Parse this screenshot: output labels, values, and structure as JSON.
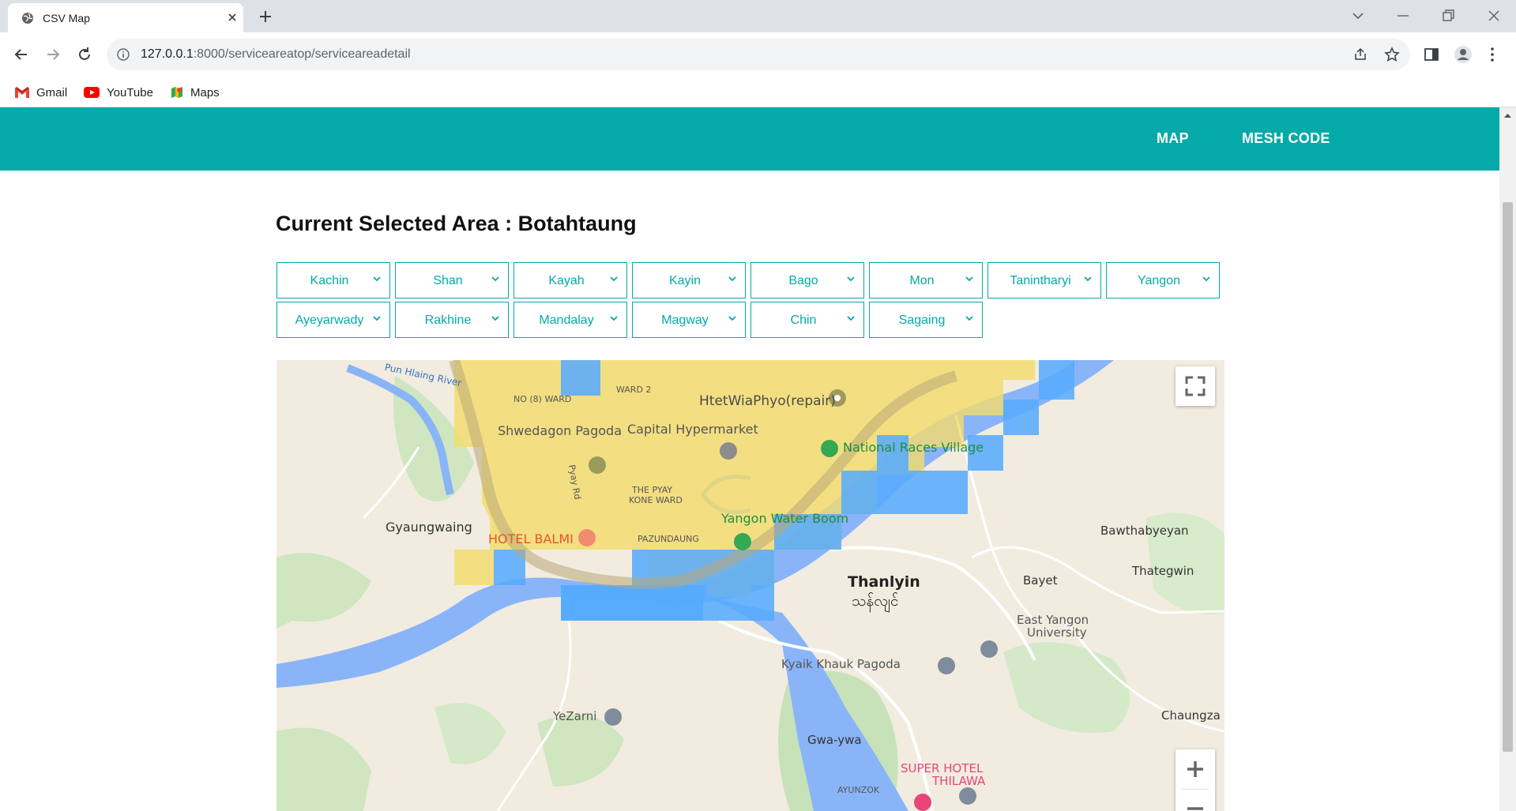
{
  "browser": {
    "tab_title": "CSV Map",
    "url_host": "127.0.0.1",
    "url_rest": ":8000/serviceareatop/serviceareadetail",
    "bookmarks": [
      "Gmail",
      "YouTube",
      "Maps"
    ]
  },
  "navbar": {
    "links": [
      "MAP",
      "MESH CODE"
    ],
    "background": "#04aaa8"
  },
  "main": {
    "heading": "Current Selected Area : Botahtaung",
    "regions_row1": [
      "Kachin",
      "Shan",
      "Kayah",
      "Kayin",
      "Bago",
      "Mon",
      "Tanintharyi",
      "Yangon"
    ],
    "regions_row2": [
      "Ayeyarwady",
      "Rakhine",
      "Mandalay",
      "Magway",
      "Chin",
      "Sagaing"
    ]
  },
  "map": {
    "labels": {
      "pun_hlaing_river": "Pun Hlaing River",
      "no8_ward": "NO (8) WARD",
      "ward2": "WARD 2",
      "htet": "HtetWiaPhyo(repair)",
      "shwedagon": "Shwedagon Pagoda",
      "capital": "Capital Hypermarket",
      "national_races": "National Races Village",
      "pyay_rd": "Pyay Rd",
      "the_pyay": "THE PYAY",
      "kone_ward": "KONE WARD",
      "gyaungwaing": "Gyaungwaing",
      "hotel_balmi": "HOTEL BALMI",
      "pazundaung": "PAZUNDAUNG",
      "water_boom": "Yangon Water Boom",
      "bawthabyeyan": "Bawthabyeyan",
      "thanlyin": "Thanlyin",
      "thanlyin_my": "သန်လျင်",
      "bayet": "Bayet",
      "thategwin": "Thategwin",
      "east_yangon": "East Yangon",
      "university": "University",
      "kyaik_khauk": "Kyaik Khauk Pagoda",
      "yezarni": "YeZarni",
      "chaungza": "Chaungza",
      "gwa_ywa": "Gwa-ywa",
      "super_hotel": "SUPER HOTEL",
      "thilawa": "THILAWA",
      "ayunzok": "AYUNZOK"
    },
    "controls": [
      "fullscreen-icon",
      "zoom-in-icon",
      "zoom-out-icon"
    ],
    "overlay_colors": {
      "yellow": "#f4dc6a",
      "blue": "#55aaff"
    }
  }
}
